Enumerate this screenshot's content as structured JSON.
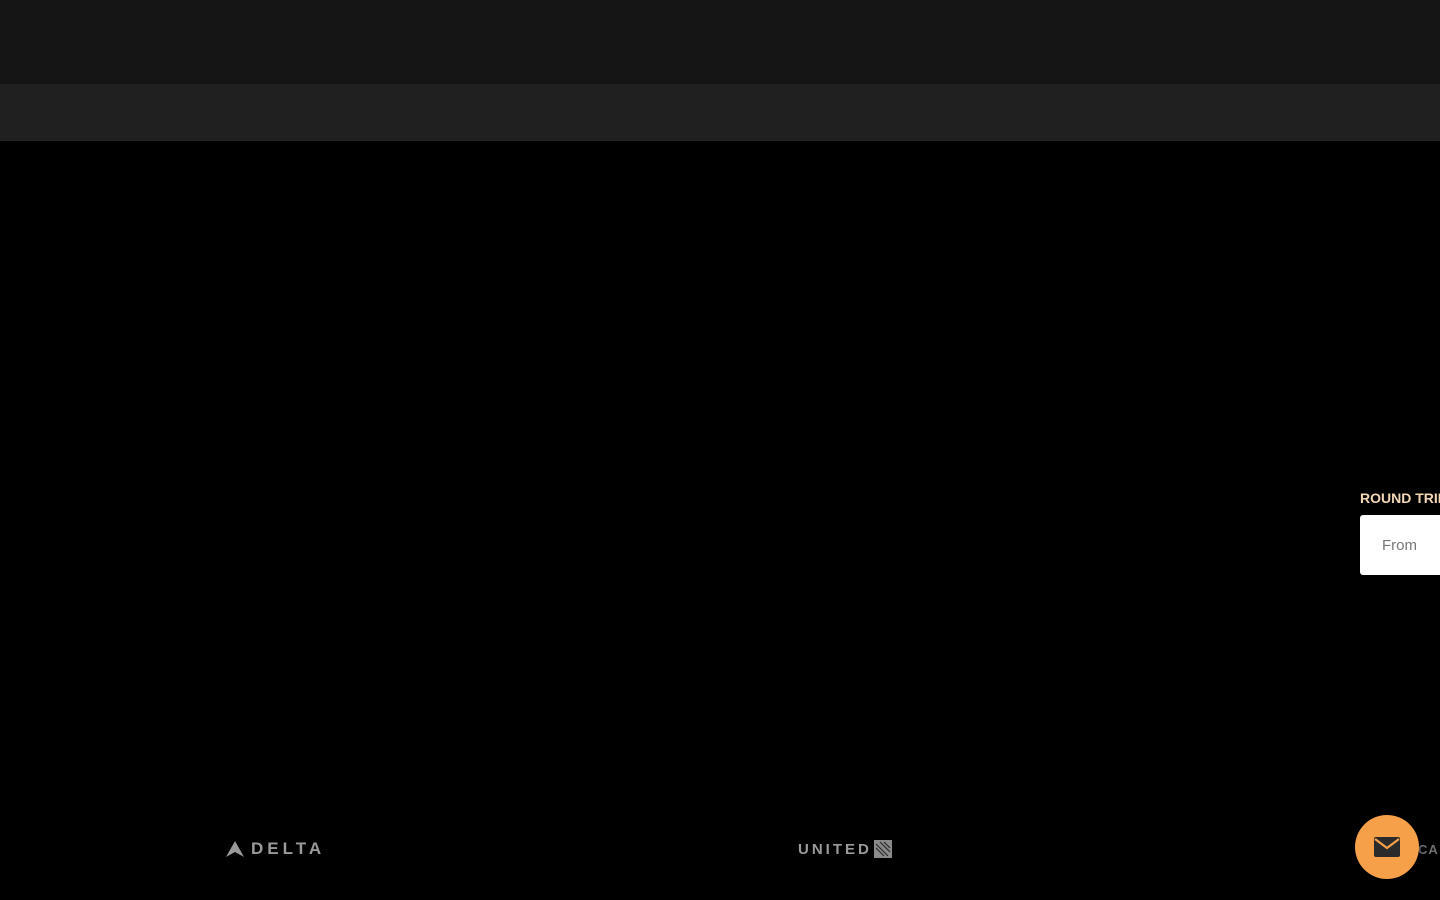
{
  "search": {
    "trip_type_label": "ROUND TRIP",
    "from_placeholder": "From"
  },
  "airlines": {
    "delta": "DELTA",
    "united": "UNITED",
    "partial": "CA"
  },
  "icons": {
    "chat": "mail-icon",
    "delta_logo": "delta-triangle-icon",
    "united_logo": "united-globe-icon"
  },
  "colors": {
    "accent": "#f6a04a",
    "label": "#f3d6b4",
    "background": "#000000",
    "header": "#151515",
    "subheader": "#202020"
  }
}
